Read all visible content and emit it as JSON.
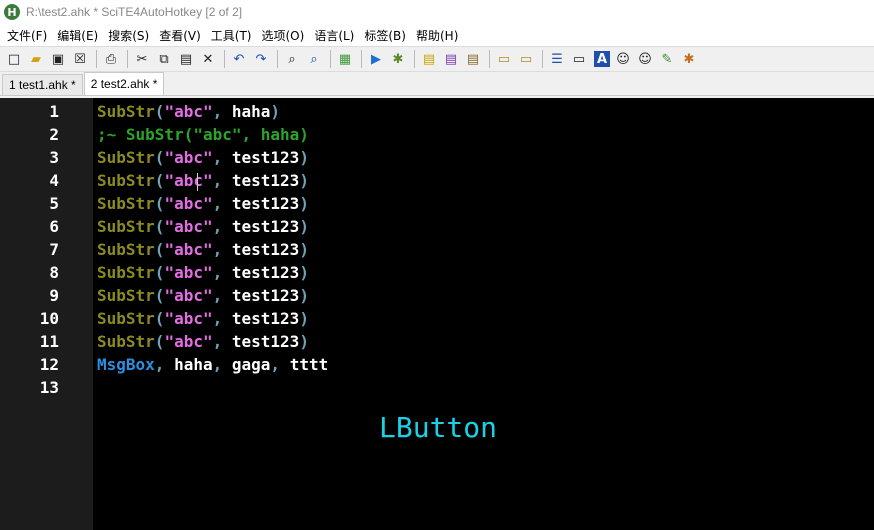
{
  "window": {
    "title": "R:\\test2.ahk * SciTE4AutoHotkey [2 of 2]",
    "icon_label": "H"
  },
  "menu": [
    "文件(F)",
    "编辑(E)",
    "搜索(S)",
    "查看(V)",
    "工具(T)",
    "选项(O)",
    "语言(L)",
    "标签(B)",
    "帮助(H)"
  ],
  "toolbar_icons": {
    "new": "□",
    "open": "▰",
    "save": "▣",
    "close": "☒",
    "print": "⎙",
    "cut": "✂",
    "copy": "⧉",
    "paste": "▤",
    "delete": "✕",
    "undo": "↶",
    "redo": "↷",
    "find": "⌕",
    "replace": "⌕",
    "compile": "▦",
    "run": "▶",
    "debug": "✱",
    "notes1": "▤",
    "notes2": "▤",
    "notes3": "▤",
    "view1": "▭",
    "view2": "▭",
    "list": "☰",
    "window": "▭",
    "text": "A",
    "user": "☺",
    "user2": "☺",
    "tools": "✎",
    "bug": "✱"
  },
  "tabs": [
    "1 test1.ahk *",
    "2 test2.ahk *"
  ],
  "line_numbers": [
    "1",
    "2",
    "3",
    "4",
    "5",
    "6",
    "7",
    "8",
    "9",
    "10",
    "11",
    "12",
    "13"
  ],
  "code": {
    "l1": {
      "fn": "SubStr",
      "open": "(",
      "str": "\"abc\"",
      "comma": ",",
      "arg": " haha",
      "close": ")"
    },
    "l2": {
      "comment": ";~ SubStr(\"abc\", haha)"
    },
    "repeat_fn": "SubStr",
    "repeat_str": "\"abc\"",
    "repeat_arg": " test123",
    "l12": {
      "cmd": "MsgBox",
      "c1": ",",
      "a1": " haha",
      "c2": ",",
      "a2": " gaga",
      "c3": ",",
      "a3": " tttt"
    }
  },
  "overlay_text": "LButton"
}
